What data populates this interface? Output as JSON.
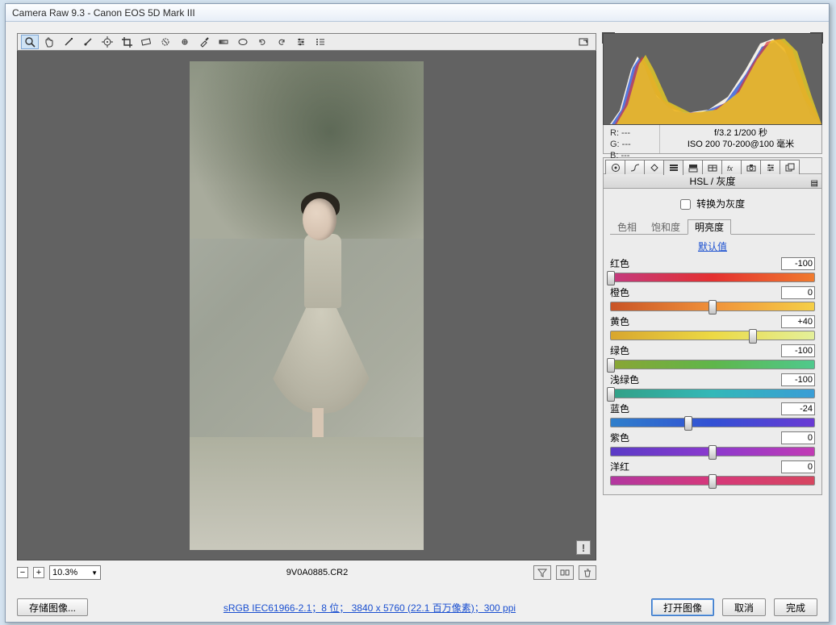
{
  "title": "Camera Raw 9.3  -  Canon EOS 5D Mark III",
  "filename": "9V0A0885.CR2",
  "zoom": "10.3%",
  "toolbar_icons": [
    "zoom",
    "hand",
    "eyedropper-white",
    "eyedropper-color",
    "target",
    "crop",
    "straighten",
    "spot-heal",
    "redeye",
    "brush",
    "graduated",
    "radial",
    "rotate-ccw",
    "rotate-cw",
    "prefs",
    "list",
    "fullscreen"
  ],
  "rgb": {
    "r": "R:  ---",
    "g": "G:  ---",
    "b": "B:  ---"
  },
  "camera": {
    "line1": "f/3.2   1/200 秒",
    "line2": "ISO 200   70-200@100 毫米"
  },
  "panel_tabs": [
    "basic",
    "curve",
    "detail",
    "hsl",
    "split",
    "lens",
    "fx",
    "camera",
    "presets",
    "snapshot"
  ],
  "panel_title": "HSL / 灰度",
  "convert_gray_label": "转换为灰度",
  "subtabs": {
    "hue": "色相",
    "sat": "饱和度",
    "lum": "明亮度"
  },
  "active_subtab": "明亮度",
  "default_link": "默认值",
  "colors": [
    {
      "name": "红色",
      "value": -100,
      "grad": "linear-gradient(90deg,#c33a7f,#e43030,#f07b2e)"
    },
    {
      "name": "橙色",
      "value": 0,
      "grad": "linear-gradient(90deg,#c95426,#f0913a,#f5cf46)"
    },
    {
      "name": "黄色",
      "value": 40,
      "grad": "linear-gradient(90deg,#d8a62e,#ecd944,#e4f09a)"
    },
    {
      "name": "绿色",
      "value": -100,
      "grad": "linear-gradient(90deg,#8aa534,#5fb64a,#4fc98d)"
    },
    {
      "name": "浅绿色",
      "value": -100,
      "grad": "linear-gradient(90deg,#32a086,#33b8b8,#3a9dd6)"
    },
    {
      "name": "蓝色",
      "value": -24,
      "grad": "linear-gradient(90deg,#2f7fcb,#3250d4,#6a3ad4)"
    },
    {
      "name": "紫色",
      "value": 0,
      "grad": "linear-gradient(90deg,#5a3bc6,#8b3ace,#c23bb4)"
    },
    {
      "name": "洋红",
      "value": 0,
      "grad": "linear-gradient(90deg,#b237a0,#d6387a,#d64660)"
    }
  ],
  "bottom": {
    "save": "存储图像...",
    "info": "sRGB IEC61966-2.1；8 位； 3840 x 5760 (22.1 百万像素)；300 ppi",
    "open": "打开图像",
    "cancel": "取消",
    "done": "完成"
  }
}
